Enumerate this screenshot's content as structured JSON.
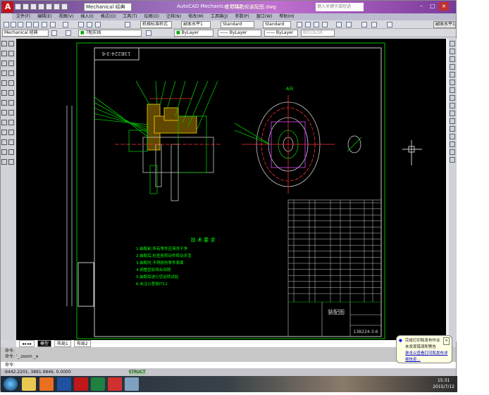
{
  "titlebar": {
    "workspace": "Mechanical 经典",
    "title": "AutoCAD Mechanical 2012",
    "file": "定位端齿轮装配图.dwg",
    "search_placeholder": "键入关键字或短语"
  },
  "menu": [
    "文件(F)",
    "编辑(E)",
    "视图(V)",
    "插入(I)",
    "格式(O)",
    "工具(T)",
    "绘图(D)",
    "注释(N)",
    "修改(M)",
    "工具箱(J)",
    "参数(P)",
    "窗口(W)",
    "帮助(H)"
  ],
  "toolbar": {
    "dim_style": "机械标准样式",
    "text_style": "副本水平1",
    "style1": "Standard",
    "style2": "Standard",
    "workspace2": "Mechanical 经典",
    "layer": "7粗实线",
    "color": "ByLayer",
    "linetype": "ByLayer",
    "lineweight": "ByLayer",
    "plotstyle": "BYCOLOR",
    "right_label": "副本水平1"
  },
  "drawing": {
    "drawing_no": "13B224-3-6",
    "title": "装配图",
    "tech_title": "技 术 要 求",
    "tech_lines": [
      "1.装配前,所有零件应清洗干净",
      "2.装配后,检查各转动件转动灵活",
      "3.装配时,不得损伤零件表面",
      "4.调整齿轮啮合间隙",
      "5.装配后进行空运转试验",
      "6.未注公差按IT12"
    ],
    "view_label": "A向"
  },
  "tabs": [
    "模型",
    "布局1",
    "布局2"
  ],
  "command": {
    "lines": [
      "命令:",
      "命令: '_.zoom _e"
    ],
    "prompt": "命令:"
  },
  "status": {
    "coords": "-9442.2201, 3891.9846, 0.0000",
    "mode": "STRUCT"
  },
  "balloon": {
    "title": "完成打印和发布作业",
    "text": "未发现错误和警告",
    "link": "单击以查看打印和发布详细信息..."
  },
  "clock": {
    "time": "15:31",
    "date": "2015/7/12"
  },
  "colors": {
    "green": "#00ff00",
    "white": "#d0d0d0",
    "red": "#ff3030",
    "magenta": "#e040ff"
  }
}
